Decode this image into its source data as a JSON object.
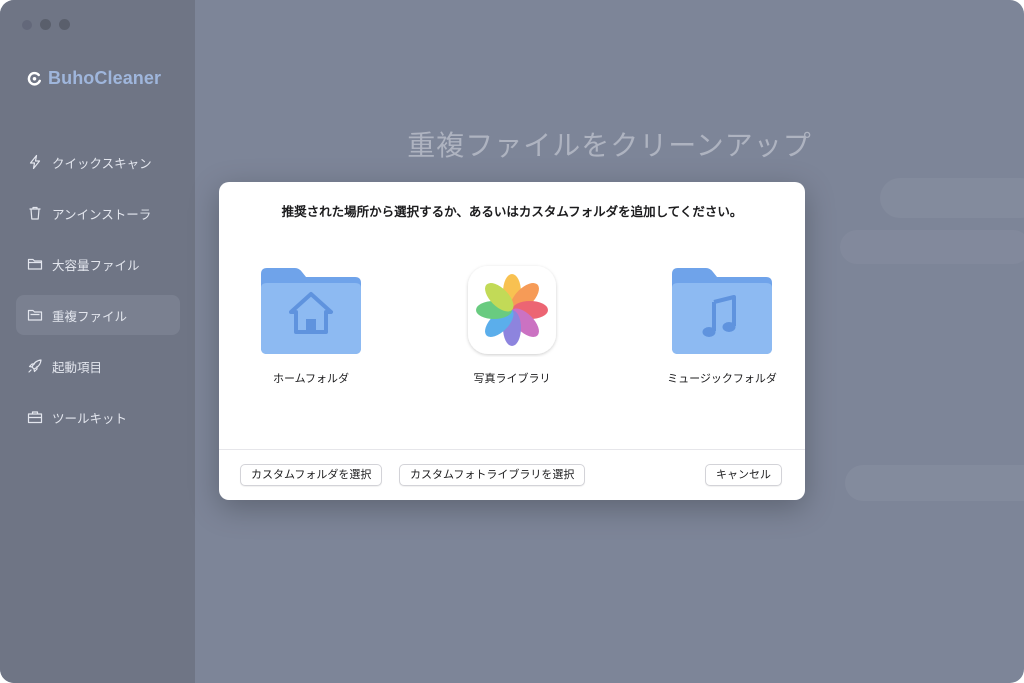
{
  "app": {
    "name": "BuhoCleaner"
  },
  "sidebar": {
    "items": [
      {
        "label": "クイックスキャン",
        "icon": "lightning-icon"
      },
      {
        "label": "アンインストーラ",
        "icon": "trash-icon"
      },
      {
        "label": "大容量ファイル",
        "icon": "folder-icon"
      },
      {
        "label": "重複ファイル",
        "icon": "duplicate-folder-icon",
        "active": true
      },
      {
        "label": "起動項目",
        "icon": "rocket-icon"
      },
      {
        "label": "ツールキット",
        "icon": "toolkit-icon"
      }
    ]
  },
  "main": {
    "title": "重複ファイルをクリーンアップ"
  },
  "dialog": {
    "prompt": "推奨された場所から選択するか、あるいはカスタムフォルダを追加してください。",
    "locations": [
      {
        "label": "ホームフォルダ",
        "icon": "home-folder-icon"
      },
      {
        "label": "写真ライブラリ",
        "icon": "photos-app-icon"
      },
      {
        "label": "ミュージックフォルダ",
        "icon": "music-folder-icon"
      }
    ],
    "buttons": {
      "custom_folder": "カスタムフォルダを選択",
      "custom_photo_library": "カスタムフォトライブラリを選択",
      "cancel": "キャンセル"
    }
  },
  "colors": {
    "brand": "#9fb6dc",
    "folder": "#8ab4f0",
    "backdrop": "#7d8598",
    "sidebar": "#6f7585"
  }
}
